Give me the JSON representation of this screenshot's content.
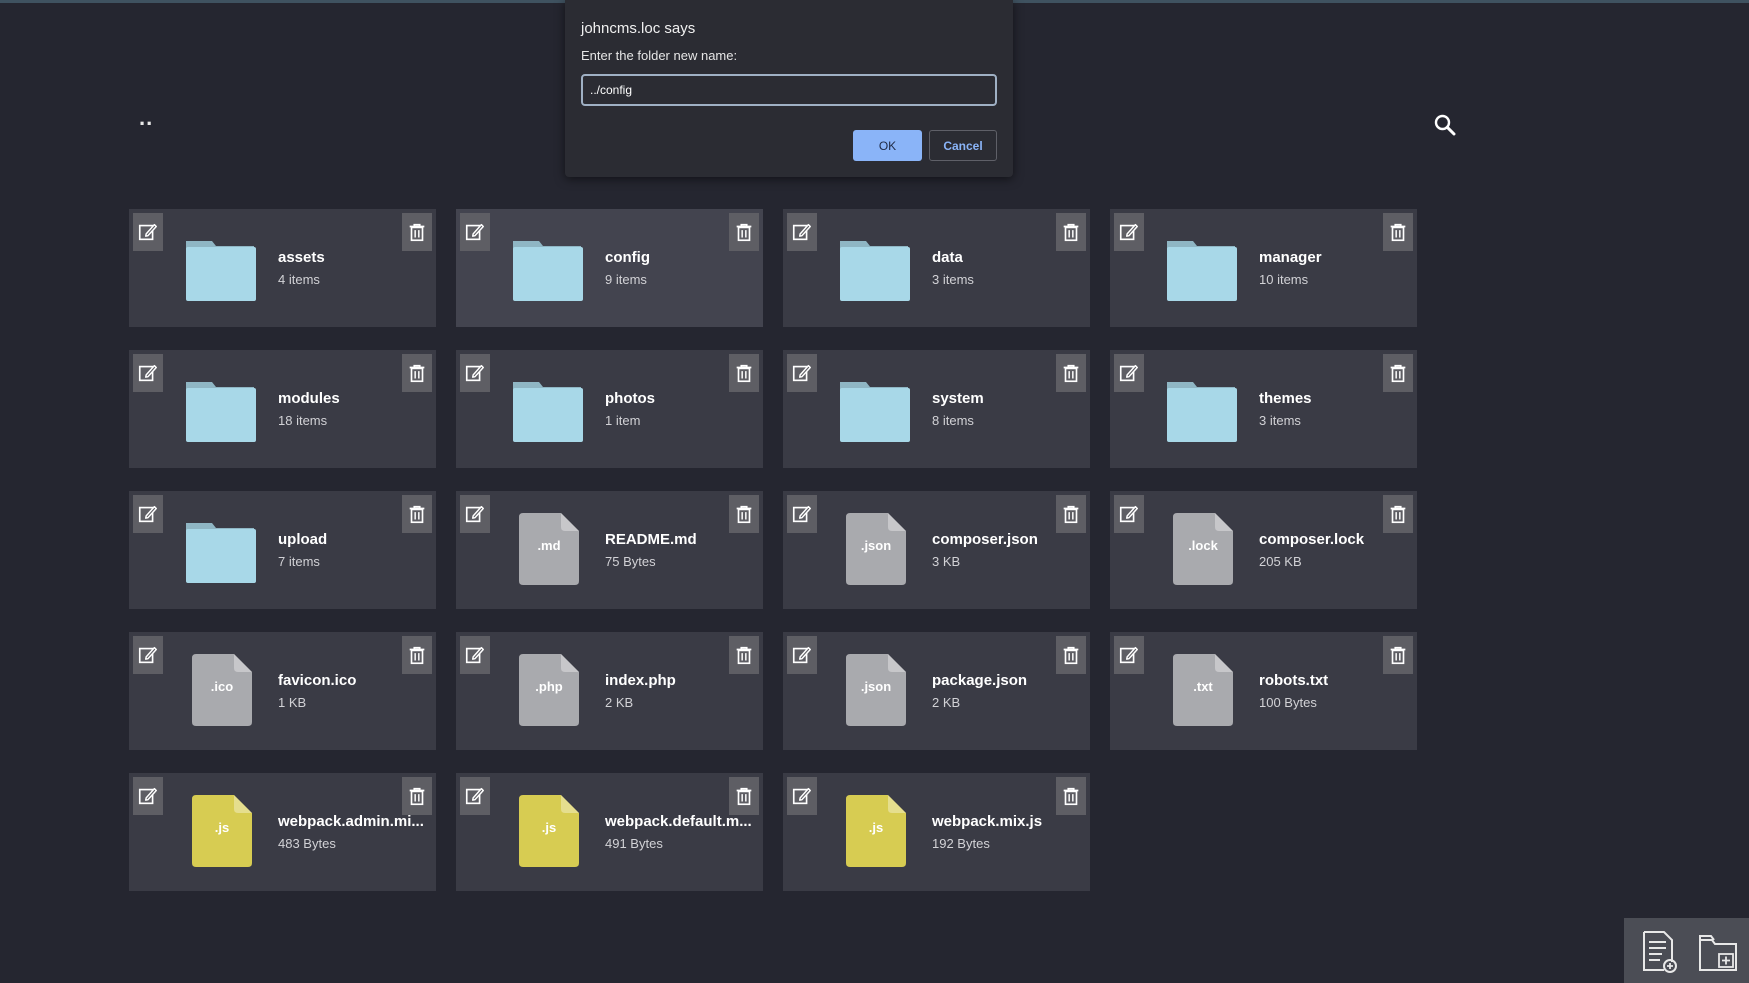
{
  "browser": {
    "accent_bar_color": "#3f5260"
  },
  "toolbar": {
    "parent_dir_label": "..",
    "search_icon": "search-icon"
  },
  "colors": {
    "background": "#252630",
    "card": "#3a3b45",
    "folder": "#a8d8e8",
    "folder_tab": "#8fb6c4",
    "generic_file": "#a9aaae",
    "js_file": "#d7cc52"
  },
  "items": [
    {
      "type": "folder",
      "name": "assets",
      "meta": "4 items"
    },
    {
      "type": "folder",
      "name": "config",
      "meta": "9 items",
      "highlighted": true
    },
    {
      "type": "folder",
      "name": "data",
      "meta": "3 items"
    },
    {
      "type": "folder",
      "name": "manager",
      "meta": "10 items"
    },
    {
      "type": "folder",
      "name": "modules",
      "meta": "18 items"
    },
    {
      "type": "folder",
      "name": "photos",
      "meta": "1 item"
    },
    {
      "type": "folder",
      "name": "system",
      "meta": "8 items"
    },
    {
      "type": "folder",
      "name": "themes",
      "meta": "3 items"
    },
    {
      "type": "folder",
      "name": "upload",
      "meta": "7 items"
    },
    {
      "type": "file",
      "ext": ".md",
      "name": "README.md",
      "meta": "75 Bytes"
    },
    {
      "type": "file",
      "ext": ".json",
      "name": "composer.json",
      "meta": "3 KB"
    },
    {
      "type": "file",
      "ext": ".lock",
      "name": "composer.lock",
      "meta": "205 KB"
    },
    {
      "type": "file",
      "ext": ".ico",
      "name": "favicon.ico",
      "meta": "1 KB"
    },
    {
      "type": "file",
      "ext": ".php",
      "name": "index.php",
      "meta": "2 KB"
    },
    {
      "type": "file",
      "ext": ".json",
      "name": "package.json",
      "meta": "2 KB"
    },
    {
      "type": "file",
      "ext": ".txt",
      "name": "robots.txt",
      "meta": "100 Bytes"
    },
    {
      "type": "file",
      "ext": ".js",
      "name": "webpack.admin.mi...",
      "meta": "483 Bytes"
    },
    {
      "type": "file",
      "ext": ".js",
      "name": "webpack.default.m...",
      "meta": "491 Bytes"
    },
    {
      "type": "file",
      "ext": ".js",
      "name": "webpack.mix.js",
      "meta": "192 Bytes"
    }
  ],
  "card_icons": {
    "edit": "edit-icon",
    "delete": "trash-icon"
  },
  "fab": {
    "new_file_icon": "new-file-icon",
    "new_folder_icon": "new-folder-icon"
  },
  "dialog": {
    "title": "johncms.loc says",
    "message": "Enter the folder new name:",
    "input_value": "../config",
    "ok_label": "OK",
    "cancel_label": "Cancel"
  }
}
